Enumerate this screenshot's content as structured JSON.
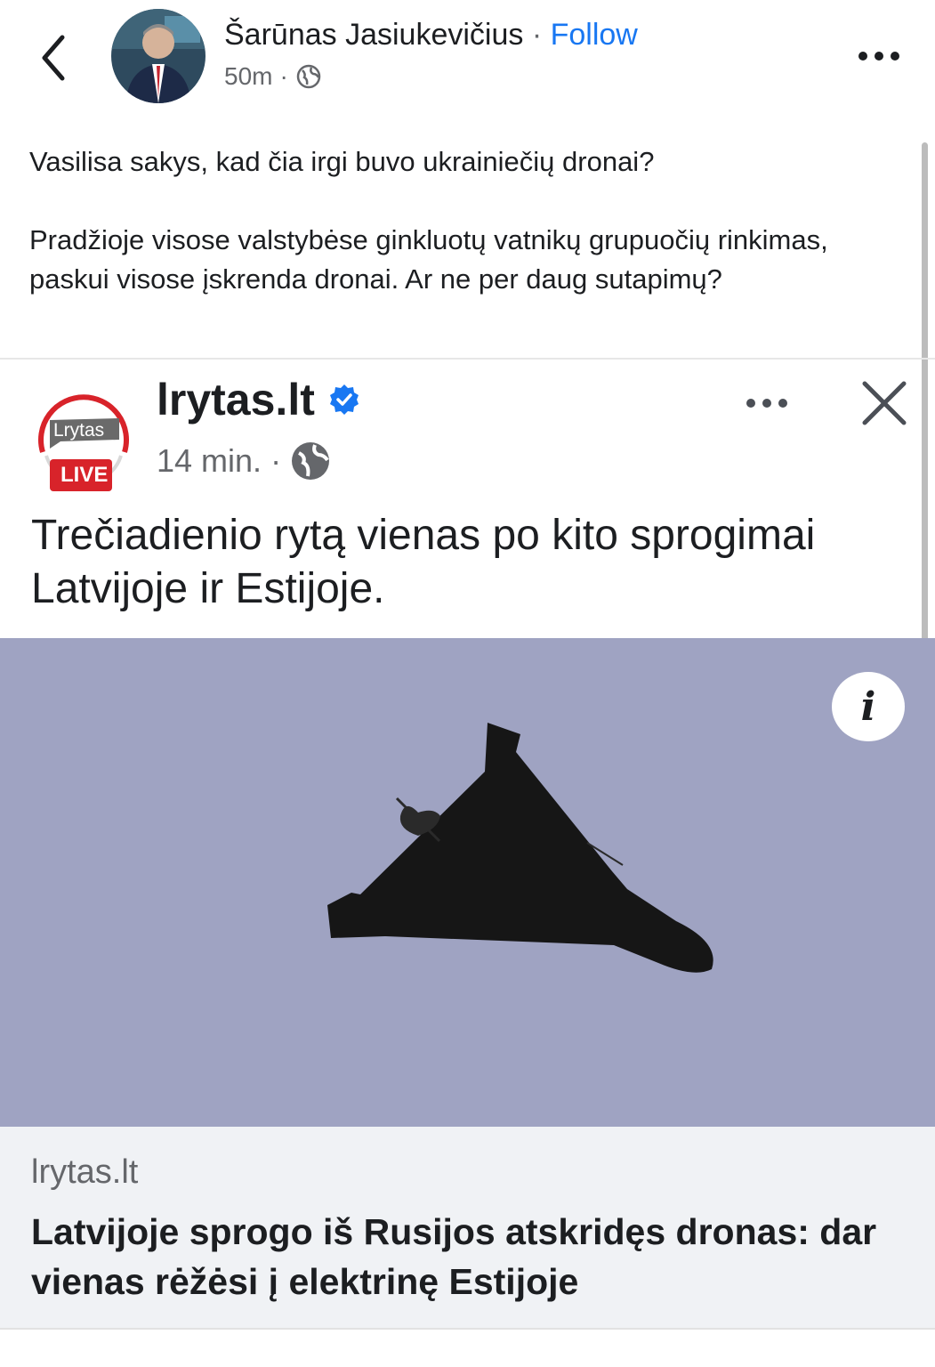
{
  "header": {
    "author_name": "Šarūnas Jasiukevičius",
    "separator": " · ",
    "follow_label": "Follow",
    "time": "50m",
    "meta_separator": "·",
    "privacy_icon": "globe-icon",
    "more_icon": "more-horizontal-icon",
    "back_icon": "chevron-left-icon"
  },
  "post": {
    "paragraphs": [
      "Vasilisa sakys, kad čia irgi buvo ukrainiečių dronai?",
      "Pradžioje visose valstybėse ginkluotų vatnikų grupuočių rinkimas, paskui visose įskrenda dronai. Ar ne per daug sutapimų?"
    ]
  },
  "shared_post": {
    "logo_text": "Lrytas",
    "logo_badge": "LIVE",
    "page_name": "lrytas.lt",
    "verified_icon": "verified-badge-icon",
    "time": "14 min.",
    "meta_separator": "·",
    "privacy_icon": "globe-icon",
    "headline": "Trečiadienio rytą vienas po kito sprogimai Latvijoje ir Estijoje.",
    "info_icon": "info-icon",
    "info_glyph": "i",
    "close_icon": "close-icon"
  },
  "link_card": {
    "domain": "lrytas.lt",
    "title": "Latvijoje sprogo iš Rusijos atskridęs dronas: dar vienas rėžėsi į elektrinę Estijoje"
  },
  "colors": {
    "accent": "#1877f2",
    "secondary_text": "#65676b",
    "link_card_bg": "#f0f2f5",
    "sky": "#9fa3c2",
    "logo_red": "#d8232a"
  }
}
